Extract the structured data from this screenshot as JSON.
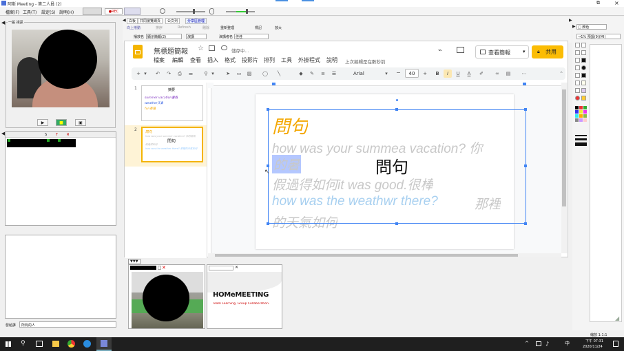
{
  "window": {
    "title": "阿斯 Meeting - 第二人員 (2)",
    "menus": [
      "檔案(F)",
      "工具(T)",
      "設定(S)",
      "說明(H)"
    ],
    "rec": "●REC"
  },
  "left": {
    "video_title": "一般 視訊",
    "video_btns": [
      "▶",
      "■",
      "▣"
    ],
    "list_cols": [
      "S",
      "T",
      "R"
    ],
    "bottom_label": "發給誰",
    "bottom_select": "所有的人"
  },
  "center_toolbar": {
    "tabs": [
      "白板",
      "共同瀏覽網頁",
      "公文列",
      "分享區管理"
    ],
    "row2": [
      "向上捲動",
      "排序",
      "Refresh",
      "刪除",
      "重新整理",
      "標記",
      "放大"
    ],
    "row3": {
      "label1": "播放名",
      "value1": "顯示簡報(2)",
      "label2": "演講",
      "label3": "演講者名",
      "value3": "佳佳"
    }
  },
  "slides": {
    "doc_title": "無標題簡報",
    "saving": "儲存中...",
    "menus": [
      "檔案",
      "編輯",
      "查看",
      "插入",
      "格式",
      "投影片",
      "排列",
      "工具",
      "外掛程式",
      "說明"
    ],
    "last_edit": "上次編輯是在數秒前",
    "present_label": "查看簡報",
    "share_label": "共用",
    "font_name": "Arial",
    "font_size": "40",
    "zoom": "−",
    "thumbs": [
      {
        "num": "1",
        "title": "摘要",
        "lines": [
          "summer vacation暑假",
          "weather天氣",
          "fun有趣"
        ]
      },
      {
        "num": "2",
        "title": "問句",
        "lines": [
          "how was your summer vacation? 你的暑假",
          "假過得如何",
          "how was the weather there? 那裡的天氣如何"
        ]
      }
    ],
    "slide": {
      "title": "問句",
      "line1a": "how was your summea vacation? 你",
      "line1b": "的暑",
      "line2": "假過得如何it  was  good.很棒",
      "line3a": "how was the weathwr there?",
      "line3b": "那裡",
      "line4": "的天氣如何",
      "center_text": "問句"
    }
  },
  "thumbs_bar": {
    "tab": "▼▼▼",
    "logo_text": "HOMeMEETING",
    "logo_tagline": "Team Learning, Group Collaboration."
  },
  "right": {
    "top_select": "□ 顏色",
    "top_select2": "→1% 預設(9)(Ml)"
  },
  "status": {
    "zoom": "縮放 1:1:1"
  },
  "taskbar": {
    "time": "下午 07:31",
    "date": "2020/11/24",
    "lang": "中"
  },
  "colors": {
    "accent": "#4285f4",
    "share": "#fbbc04",
    "orange": "#f4a700",
    "gray_text": "#c8c8c8",
    "blue_text": "#a8d0f0"
  }
}
